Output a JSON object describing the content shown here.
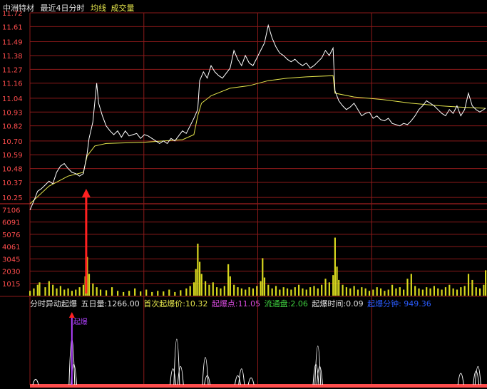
{
  "header": {
    "stock_name": "中洲特材",
    "period": "最近4日分时",
    "avg_line_label": "均线",
    "volume_label": "成交量"
  },
  "indicator": {
    "title": "分时异动起爆",
    "five_day_vol_label": "五日量:",
    "five_day_vol_value": "1266.00",
    "first_price_label": "首次起爆价:",
    "first_price_value": "10.32",
    "burst_point_label": "起爆点:",
    "burst_point_value": "11.05",
    "float_label": "流通盘:",
    "float_value": "2.06",
    "time_label": "起爆时间:",
    "time_value": "0.09",
    "extra_text": "起爆分钟: 949.36",
    "marker_label": "起爆"
  },
  "colors": {
    "grid": "#8b1a1a",
    "price_line": "#ffffff",
    "avg_line": "#e6e64c",
    "volume_bar": "#d8d81e",
    "tick_label": "#ff4d4d",
    "lower_tick_label": "#3fd13f",
    "arrow": "#ff2020",
    "marker": "#b040ff"
  },
  "chart_data": [
    {
      "type": "line",
      "name": "price",
      "y_ticks": [
        "11.72",
        "11.61",
        "11.49",
        "11.38",
        "11.27",
        "11.16",
        "11.04",
        "10.93",
        "10.82",
        "10.70",
        "10.59",
        "10.48",
        "10.37",
        "10.25"
      ],
      "y_range": [
        10.2,
        11.72
      ],
      "days": 4,
      "series": [
        {
          "name": "price",
          "points": [
            [
              0,
              10.15
            ],
            [
              2,
              10.22
            ],
            [
              4,
              10.3
            ],
            [
              6,
              10.32
            ],
            [
              8,
              10.35
            ],
            [
              10,
              10.38
            ],
            [
              12,
              10.36
            ],
            [
              14,
              10.45
            ],
            [
              16,
              10.5
            ],
            [
              18,
              10.52
            ],
            [
              20,
              10.48
            ],
            [
              22,
              10.45
            ],
            [
              24,
              10.44
            ],
            [
              26,
              10.42
            ],
            [
              28,
              10.44
            ],
            [
              30,
              10.6
            ],
            [
              31,
              10.72
            ],
            [
              33,
              10.85
            ],
            [
              35,
              11.16
            ],
            [
              36,
              11.0
            ],
            [
              38,
              10.9
            ],
            [
              40,
              10.82
            ],
            [
              42,
              10.78
            ],
            [
              44,
              10.75
            ],
            [
              46,
              10.78
            ],
            [
              48,
              10.73
            ],
            [
              50,
              10.78
            ],
            [
              52,
              10.74
            ],
            [
              54,
              10.75
            ],
            [
              56,
              10.76
            ],
            [
              58,
              10.72
            ],
            [
              60,
              10.75
            ],
            [
              62,
              10.74
            ],
            [
              64,
              10.72
            ],
            [
              66,
              10.7
            ],
            [
              68,
              10.68
            ],
            [
              70,
              10.7
            ],
            [
              72,
              10.68
            ],
            [
              74,
              10.72
            ],
            [
              76,
              10.7
            ],
            [
              78,
              10.74
            ],
            [
              80,
              10.78
            ],
            [
              82,
              10.76
            ],
            [
              84,
              10.82
            ],
            [
              86,
              10.88
            ],
            [
              88,
              10.95
            ],
            [
              89,
              11.18
            ],
            [
              91,
              11.25
            ],
            [
              93,
              11.2
            ],
            [
              95,
              11.3
            ],
            [
              97,
              11.25
            ],
            [
              99,
              11.22
            ],
            [
              101,
              11.2
            ],
            [
              103,
              11.24
            ],
            [
              105,
              11.28
            ],
            [
              107,
              11.42
            ],
            [
              109,
              11.35
            ],
            [
              111,
              11.3
            ],
            [
              113,
              11.38
            ],
            [
              115,
              11.32
            ],
            [
              117,
              11.3
            ],
            [
              119,
              11.36
            ],
            [
              121,
              11.42
            ],
            [
              123,
              11.48
            ],
            [
              125,
              11.62
            ],
            [
              127,
              11.52
            ],
            [
              129,
              11.45
            ],
            [
              131,
              11.4
            ],
            [
              133,
              11.38
            ],
            [
              135,
              11.35
            ],
            [
              137,
              11.33
            ],
            [
              139,
              11.35
            ],
            [
              141,
              11.32
            ],
            [
              143,
              11.3
            ],
            [
              145,
              11.32
            ],
            [
              147,
              11.28
            ],
            [
              149,
              11.3
            ],
            [
              151,
              11.33
            ],
            [
              153,
              11.36
            ],
            [
              155,
              11.42
            ],
            [
              157,
              11.38
            ],
            [
              159,
              11.44
            ],
            [
              160,
              11.1
            ],
            [
              162,
              11.02
            ],
            [
              164,
              10.98
            ],
            [
              166,
              10.95
            ],
            [
              168,
              10.97
            ],
            [
              170,
              11.0
            ],
            [
              172,
              10.95
            ],
            [
              174,
              10.9
            ],
            [
              176,
              10.92
            ],
            [
              178,
              10.93
            ],
            [
              180,
              10.88
            ],
            [
              182,
              10.9
            ],
            [
              184,
              10.87
            ],
            [
              186,
              10.86
            ],
            [
              188,
              10.88
            ],
            [
              190,
              10.84
            ],
            [
              192,
              10.83
            ],
            [
              194,
              10.82
            ],
            [
              196,
              10.84
            ],
            [
              198,
              10.83
            ],
            [
              200,
              10.86
            ],
            [
              202,
              10.9
            ],
            [
              204,
              10.95
            ],
            [
              206,
              10.98
            ],
            [
              208,
              11.02
            ],
            [
              210,
              11.0
            ],
            [
              212,
              10.98
            ],
            [
              214,
              10.95
            ],
            [
              216,
              10.92
            ],
            [
              218,
              10.9
            ],
            [
              220,
              10.95
            ],
            [
              222,
              10.92
            ],
            [
              224,
              10.98
            ],
            [
              226,
              10.9
            ],
            [
              228,
              10.95
            ],
            [
              230,
              11.08
            ],
            [
              232,
              10.98
            ],
            [
              234,
              10.95
            ],
            [
              236,
              10.93
            ],
            [
              239,
              10.96
            ]
          ]
        },
        {
          "name": "avg",
          "points": [
            [
              0,
              10.2
            ],
            [
              10,
              10.34
            ],
            [
              20,
              10.42
            ],
            [
              28,
              10.45
            ],
            [
              30,
              10.58
            ],
            [
              34,
              10.66
            ],
            [
              40,
              10.68
            ],
            [
              60,
              10.69
            ],
            [
              80,
              10.71
            ],
            [
              86,
              10.75
            ],
            [
              88,
              10.9
            ],
            [
              90,
              11.0
            ],
            [
              95,
              11.06
            ],
            [
              105,
              11.12
            ],
            [
              115,
              11.14
            ],
            [
              125,
              11.18
            ],
            [
              135,
              11.2
            ],
            [
              145,
              11.21
            ],
            [
              159,
              11.22
            ],
            [
              160,
              11.08
            ],
            [
              170,
              11.05
            ],
            [
              185,
              11.03
            ],
            [
              200,
              11.0
            ],
            [
              215,
              10.98
            ],
            [
              225,
              10.97
            ],
            [
              239,
              10.96
            ]
          ]
        }
      ]
    },
    {
      "type": "bar",
      "name": "volume",
      "y_ticks": [
        "7106",
        "6091",
        "5076",
        "4061",
        "3045",
        "2030",
        "1015"
      ],
      "y_range": [
        0,
        7600
      ],
      "bars": [
        [
          0,
          400
        ],
        [
          2,
          600
        ],
        [
          4,
          900
        ],
        [
          5,
          1100
        ],
        [
          8,
          700
        ],
        [
          10,
          1200
        ],
        [
          12,
          900
        ],
        [
          14,
          600
        ],
        [
          16,
          800
        ],
        [
          18,
          500
        ],
        [
          20,
          600
        ],
        [
          22,
          400
        ],
        [
          24,
          500
        ],
        [
          26,
          700
        ],
        [
          28,
          900
        ],
        [
          29,
          1600
        ],
        [
          30,
          3200
        ],
        [
          31,
          1800
        ],
        [
          33,
          1000
        ],
        [
          35,
          700
        ],
        [
          37,
          500
        ],
        [
          40,
          450
        ],
        [
          43,
          700
        ],
        [
          46,
          400
        ],
        [
          49,
          300
        ],
        [
          52,
          400
        ],
        [
          55,
          600
        ],
        [
          58,
          350
        ],
        [
          61,
          500
        ],
        [
          64,
          300
        ],
        [
          67,
          400
        ],
        [
          70,
          350
        ],
        [
          73,
          500
        ],
        [
          76,
          300
        ],
        [
          79,
          450
        ],
        [
          82,
          600
        ],
        [
          84,
          800
        ],
        [
          86,
          1100
        ],
        [
          87,
          2200
        ],
        [
          88,
          4300
        ],
        [
          89,
          2800
        ],
        [
          90,
          1800
        ],
        [
          92,
          1200
        ],
        [
          94,
          900
        ],
        [
          96,
          1100
        ],
        [
          98,
          700
        ],
        [
          100,
          600
        ],
        [
          102,
          800
        ],
        [
          104,
          2600
        ],
        [
          105,
          1600
        ],
        [
          107,
          900
        ],
        [
          109,
          700
        ],
        [
          111,
          600
        ],
        [
          113,
          500
        ],
        [
          115,
          700
        ],
        [
          117,
          600
        ],
        [
          119,
          800
        ],
        [
          121,
          1200
        ],
        [
          122,
          3100
        ],
        [
          123,
          1500
        ],
        [
          125,
          900
        ],
        [
          127,
          600
        ],
        [
          129,
          800
        ],
        [
          131,
          500
        ],
        [
          133,
          700
        ],
        [
          135,
          600
        ],
        [
          137,
          500
        ],
        [
          139,
          700
        ],
        [
          141,
          900
        ],
        [
          143,
          600
        ],
        [
          145,
          500
        ],
        [
          147,
          700
        ],
        [
          149,
          800
        ],
        [
          151,
          600
        ],
        [
          153,
          900
        ],
        [
          155,
          1400
        ],
        [
          157,
          1100
        ],
        [
          159,
          1700
        ],
        [
          160,
          4800
        ],
        [
          161,
          2400
        ],
        [
          162,
          1300
        ],
        [
          164,
          900
        ],
        [
          166,
          700
        ],
        [
          168,
          600
        ],
        [
          170,
          800
        ],
        [
          172,
          500
        ],
        [
          174,
          700
        ],
        [
          176,
          600
        ],
        [
          178,
          400
        ],
        [
          180,
          500
        ],
        [
          182,
          700
        ],
        [
          184,
          600
        ],
        [
          186,
          400
        ],
        [
          188,
          500
        ],
        [
          190,
          900
        ],
        [
          192,
          600
        ],
        [
          194,
          700
        ],
        [
          196,
          500
        ],
        [
          198,
          1400
        ],
        [
          200,
          1800
        ],
        [
          202,
          800
        ],
        [
          204,
          600
        ],
        [
          206,
          500
        ],
        [
          208,
          700
        ],
        [
          210,
          600
        ],
        [
          212,
          800
        ],
        [
          214,
          600
        ],
        [
          216,
          500
        ],
        [
          218,
          700
        ],
        [
          220,
          900
        ],
        [
          222,
          600
        ],
        [
          224,
          500
        ],
        [
          226,
          700
        ],
        [
          228,
          800
        ],
        [
          230,
          1800
        ],
        [
          232,
          1300
        ],
        [
          234,
          700
        ],
        [
          236,
          600
        ],
        [
          238,
          900
        ],
        [
          239,
          2100
        ]
      ]
    },
    {
      "type": "line",
      "name": "burst indicator",
      "spikes": [
        [
          3,
          0.12
        ],
        [
          22,
          1.0
        ],
        [
          23,
          0.45
        ],
        [
          75,
          0.35
        ],
        [
          77,
          1.0
        ],
        [
          79,
          0.4
        ],
        [
          92,
          0.6
        ],
        [
          93,
          0.2
        ],
        [
          109,
          0.2
        ],
        [
          111,
          0.35
        ],
        [
          116,
          0.15
        ],
        [
          150,
          0.45
        ],
        [
          151,
          0.85
        ],
        [
          152,
          0.4
        ],
        [
          226,
          0.25
        ],
        [
          234,
          0.3
        ],
        [
          235,
          0.4
        ]
      ]
    }
  ]
}
